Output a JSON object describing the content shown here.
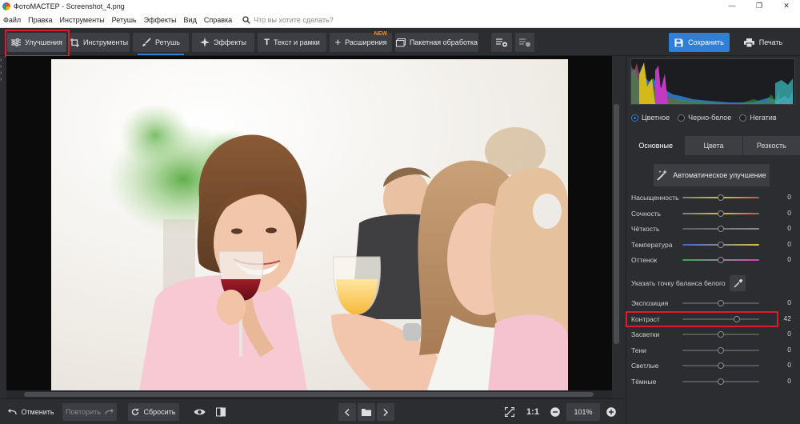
{
  "window": {
    "title": "ФотоМАСТЕР - Screenshot_4.png",
    "min": "—",
    "max": "❐",
    "close": "✕"
  },
  "menu": {
    "items": [
      "Файл",
      "Правка",
      "Инструменты",
      "Ретушь",
      "Эффекты",
      "Вид",
      "Справка"
    ],
    "search_placeholder": "Что вы хотите сделать?"
  },
  "toolbar": {
    "tabs": [
      {
        "label": "Улучшения",
        "icon": "sliders-icon"
      },
      {
        "label": "Инструменты",
        "icon": "crop-icon"
      },
      {
        "label": "Ретушь",
        "icon": "brush-icon"
      },
      {
        "label": "Эффекты",
        "icon": "sparkle-icon"
      },
      {
        "label": "Текст и рамки",
        "icon": "text-icon"
      },
      {
        "label": "Расширения",
        "icon": "plus-icon",
        "badge": "NEW"
      },
      {
        "label": "Пакетная обработка",
        "icon": "batch-icon"
      }
    ],
    "save_label": "Сохранить",
    "print_label": "Печать"
  },
  "panel": {
    "color_modes": [
      {
        "label": "Цветное",
        "selected": true
      },
      {
        "label": "Черно-белое",
        "selected": false
      },
      {
        "label": "Негатив",
        "selected": false
      }
    ],
    "tabs": [
      "Основные",
      "Цвета",
      "Резкость"
    ],
    "auto_button": "Автоматическое улучшение",
    "white_balance_label": "Указать точку баланса белого",
    "sliders_top": [
      {
        "label": "Насыщенность",
        "value": 0,
        "track": "saturation"
      },
      {
        "label": "Сочность",
        "value": 0,
        "track": "vibrance"
      },
      {
        "label": "Чёткость",
        "value": 0,
        "track": "gray"
      },
      {
        "label": "Температура",
        "value": 0,
        "track": "temperature"
      },
      {
        "label": "Оттенок",
        "value": 0,
        "track": "tint"
      }
    ],
    "sliders_bottom": [
      {
        "label": "Экспозиция",
        "value": 0
      },
      {
        "label": "Контраст",
        "value": 42
      },
      {
        "label": "Засветки",
        "value": 0
      },
      {
        "label": "Тени",
        "value": 0
      },
      {
        "label": "Светлые",
        "value": 0
      },
      {
        "label": "Тёмные",
        "value": 0
      }
    ]
  },
  "bottom": {
    "undo": "Отменить",
    "redo": "Повторить",
    "reset": "Сбросить",
    "ratio": "1:1",
    "zoom": "101%"
  },
  "colors": {
    "accent": "#2f7fd8",
    "highlight": "#d9202a",
    "bg": "#2b2d31"
  }
}
